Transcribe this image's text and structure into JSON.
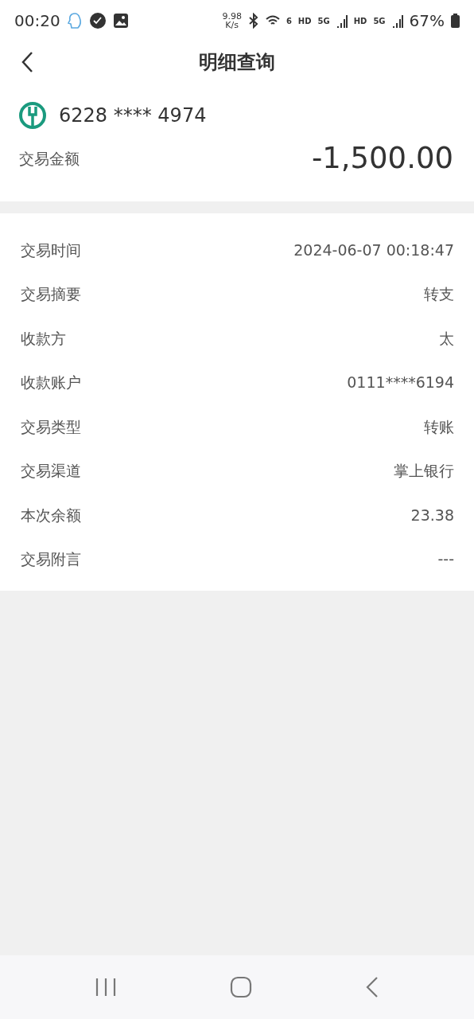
{
  "status_bar": {
    "time": "00:20",
    "net_speed": "9.98",
    "net_unit": "K/s",
    "wifi_badge": "6",
    "hd_1": "HD",
    "net_1": "5G",
    "hd_2": "HD",
    "net_2": "5G",
    "battery": "67%"
  },
  "header": {
    "title": "明细查询"
  },
  "card": {
    "number": "6228 **** 4974",
    "amount_label": "交易金额",
    "amount": "-1,500.00"
  },
  "details": [
    {
      "label": "交易时间",
      "value": "2024-06-07 00:18:47"
    },
    {
      "label": "交易摘要",
      "value": "转支"
    },
    {
      "label": "收款方",
      "value": "太"
    },
    {
      "label": "收款账户",
      "value": "0111****6194"
    },
    {
      "label": "交易类型",
      "value": "转账"
    },
    {
      "label": "交易渠道",
      "value": "掌上银行"
    },
    {
      "label": "本次余额",
      "value": "23.38"
    },
    {
      "label": "交易附言",
      "value": "---"
    }
  ]
}
